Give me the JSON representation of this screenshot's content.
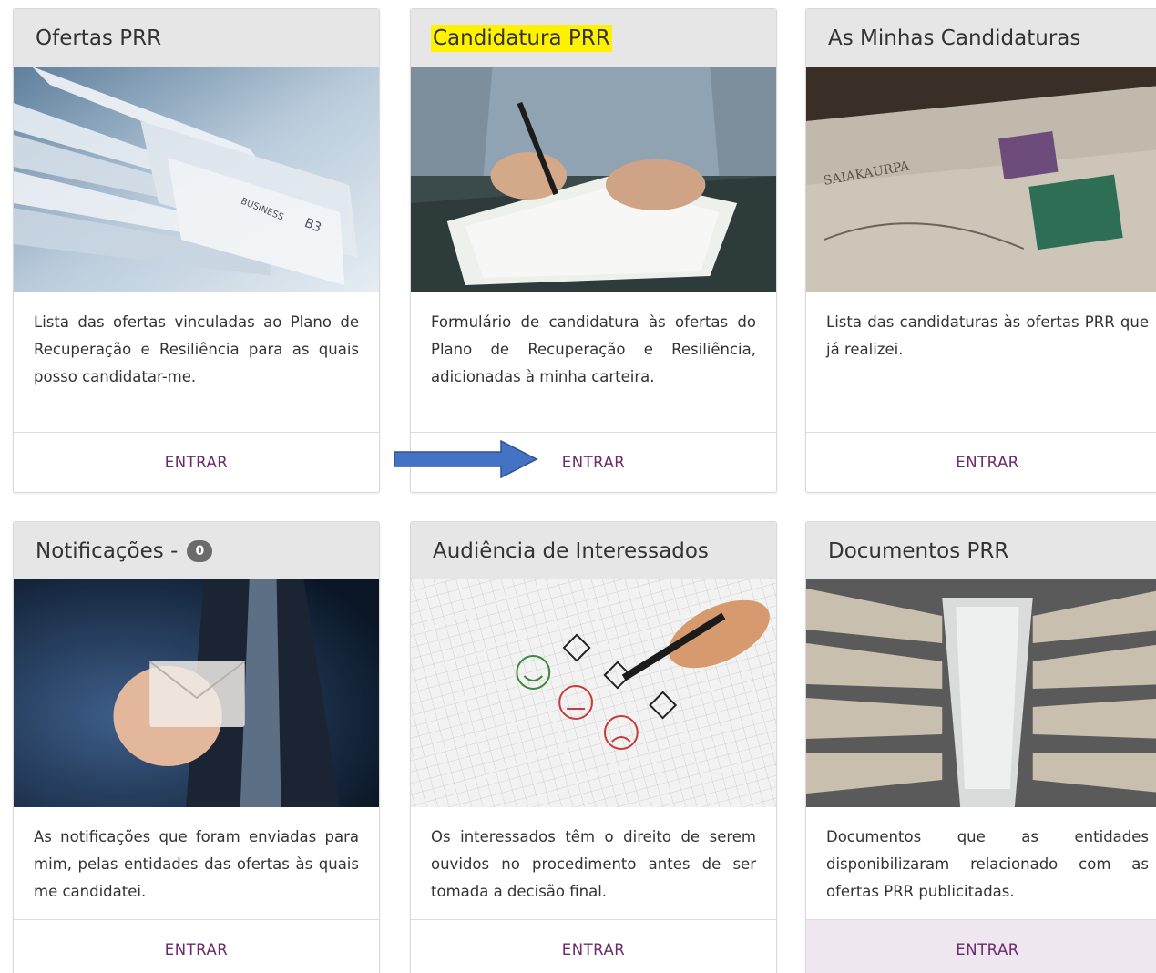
{
  "cards": [
    {
      "title": "Ofertas PRR",
      "description": "Lista das ofertas vinculadas ao Plano de Recuperação e Resiliência para as quais posso candidatar-me.",
      "action": "ENTRAR",
      "image": "newspapers"
    },
    {
      "title": "Candidatura PRR",
      "description": "Formulário de candidatura às ofertas do Plano de Recuperação e Resiliência, adicionadas à minha carteira.",
      "action": "ENTRAR",
      "image": "signing-document"
    },
    {
      "title": "As Minhas Candidaturas",
      "description": "Lista das candidaturas às ofertas PRR que já realizei.",
      "action": "ENTRAR",
      "image": "old-envelope"
    },
    {
      "title": "Notificações - ",
      "badge": "0",
      "description": "As notificações que foram enviadas para mim, pelas entidades das ofertas às quais me candidatei.",
      "action": "ENTRAR",
      "image": "envelope-touch"
    },
    {
      "title": "Audiência de Interessados",
      "description": "Os interessados têm o direito de serem ouvidos no procedimento antes de ser tomada a decisão final.",
      "action": "ENTRAR",
      "image": "survey-checkboxes"
    },
    {
      "title": "Documentos PRR",
      "description": "Documentos que as entidades disponibilizaram relacionado com as ofertas PRR publicitadas.",
      "action": "ENTRAR",
      "image": "archive-shelves"
    }
  ],
  "colors": {
    "header_bg": "#e6e6e6",
    "link": "#6b2a6b",
    "highlight": "#fff200",
    "arrow": "#4472c4",
    "active_footer": "#efe7f0"
  }
}
